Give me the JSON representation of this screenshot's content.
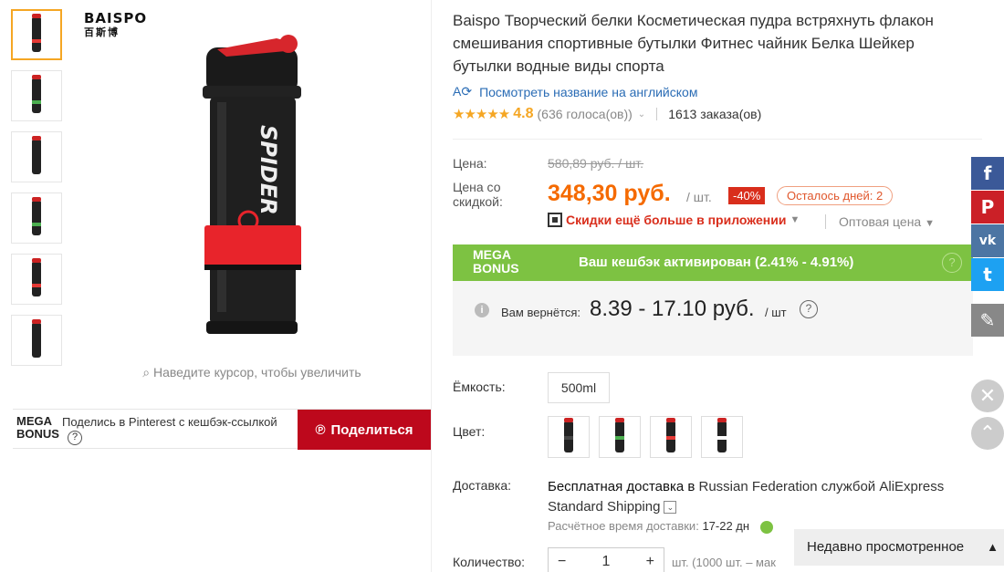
{
  "brand": {
    "name": "BAISPO",
    "sub": "百斯博"
  },
  "gallery": {
    "thumbnails": [
      {
        "band": "#e53935",
        "active": true
      },
      {
        "band": "#4caf50",
        "active": false
      },
      {
        "band": "#222222",
        "active": false
      },
      {
        "band": "#4caf50",
        "active": false
      },
      {
        "band": "#e53935",
        "active": false
      },
      {
        "band": "#222222",
        "active": false
      }
    ],
    "bottle_text": "SPIDER",
    "zoom_hint": "Наведите курсор, чтобы увеличить"
  },
  "share": {
    "mega_label": "MEGA BONUS",
    "text": "Поделись в Pinterest с кешбэк-ссылкой",
    "help": "?",
    "button_label": "Поделиться"
  },
  "product": {
    "title": "Baispo Творческий белки Косметическая пудра встряхнуть флакон смешивания спортивные бутылки Фитнес чайник Белка Шейкер бутылки водные виды спорта",
    "translate_link": "Посмотреть название на английском",
    "rating": "4.8",
    "stars": 5,
    "votes": "(636 голоса(ов))",
    "orders": "1613 заказа(ов)"
  },
  "price": {
    "label": "Цена:",
    "old": "580,89 руб. / шт.",
    "discount_label": "Цена со скидкой:",
    "new": "348,30 руб.",
    "per_unit": "/ шт.",
    "discount_badge": "-40%",
    "days_left": "Осталось дней: 2",
    "app_discount": "Скидки ещё больше в приложении",
    "wholesale": "Оптовая цена"
  },
  "mega_bonus": {
    "logo_line1": "MEGA",
    "logo_line2": "BONUS",
    "text": "Ваш кешбэк активирован (2.41% - 4.91%)",
    "help": "?",
    "cashback_label": "Вам вернётся:",
    "cashback_value": "8.39 - 17.10 руб.",
    "cashback_unit": "/ шт"
  },
  "options": {
    "capacity_label": "Ёмкость:",
    "capacity_value": "500ml",
    "color_label": "Цвет:",
    "colors": [
      {
        "band": "#444444"
      },
      {
        "band": "#4caf50"
      },
      {
        "band": "#e53935"
      },
      {
        "band": "#ffffff"
      }
    ]
  },
  "delivery": {
    "label": "Доставка:",
    "text_bold": "Бесплатная доставка в",
    "text_rest": " Russian Federation службой AliExpress Standard Shipping",
    "eta_label": "Расчётное время доставки:",
    "eta_value": "17-22 дн"
  },
  "quantity": {
    "label": "Количество:",
    "value": "1",
    "minus": "−",
    "plus": "+",
    "note": "шт. (1000 шт. – мак"
  },
  "social": {
    "facebook": "f",
    "pinterest": "P",
    "vk": "vk",
    "twitter": "t",
    "edit": "✎",
    "colors": {
      "facebook": "#3b5998",
      "pinterest": "#cb2027",
      "vk": "#4c75a3",
      "twitter": "#1da1f2",
      "edit": "#888888"
    }
  },
  "recently_viewed": "Недавно просмотренное"
}
